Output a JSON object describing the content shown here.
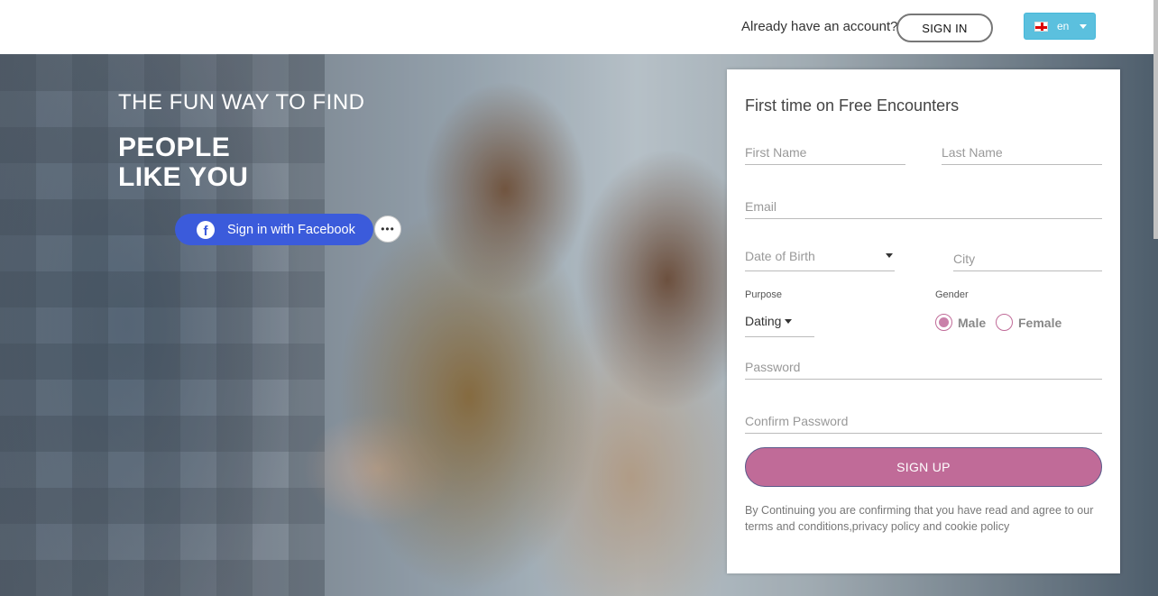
{
  "header": {
    "have_account": "Already have an account?",
    "signin_label": "SIGN IN",
    "language": "en"
  },
  "hero": {
    "tagline": "THE FUN WAY TO FIND",
    "headline_line1": "PEOPLE",
    "headline_line2": "LIKE YOU",
    "facebook_label": "Sign in with Facebook",
    "more_label": "•••"
  },
  "form": {
    "title": "First time on Free Encounters",
    "first_name_placeholder": "First Name",
    "last_name_placeholder": "Last Name",
    "email_placeholder": "Email",
    "dob_placeholder": "Date of Birth",
    "city_placeholder": "City",
    "purpose_label": "Purpose",
    "purpose_value": "Dating",
    "gender_label": "Gender",
    "gender_options": [
      "Male",
      "Female"
    ],
    "gender_selected": "Male",
    "password_placeholder": "Password",
    "confirm_password_placeholder": "Confirm Password",
    "signup_label": "SIGN UP",
    "legal_text": "By Continuing you are confirming that you have read and agree to our terms and conditions,privacy policy and cookie policy"
  },
  "colors": {
    "accent": "#c06b98",
    "facebook": "#3b5bdb",
    "language_button": "#5bc0de"
  }
}
